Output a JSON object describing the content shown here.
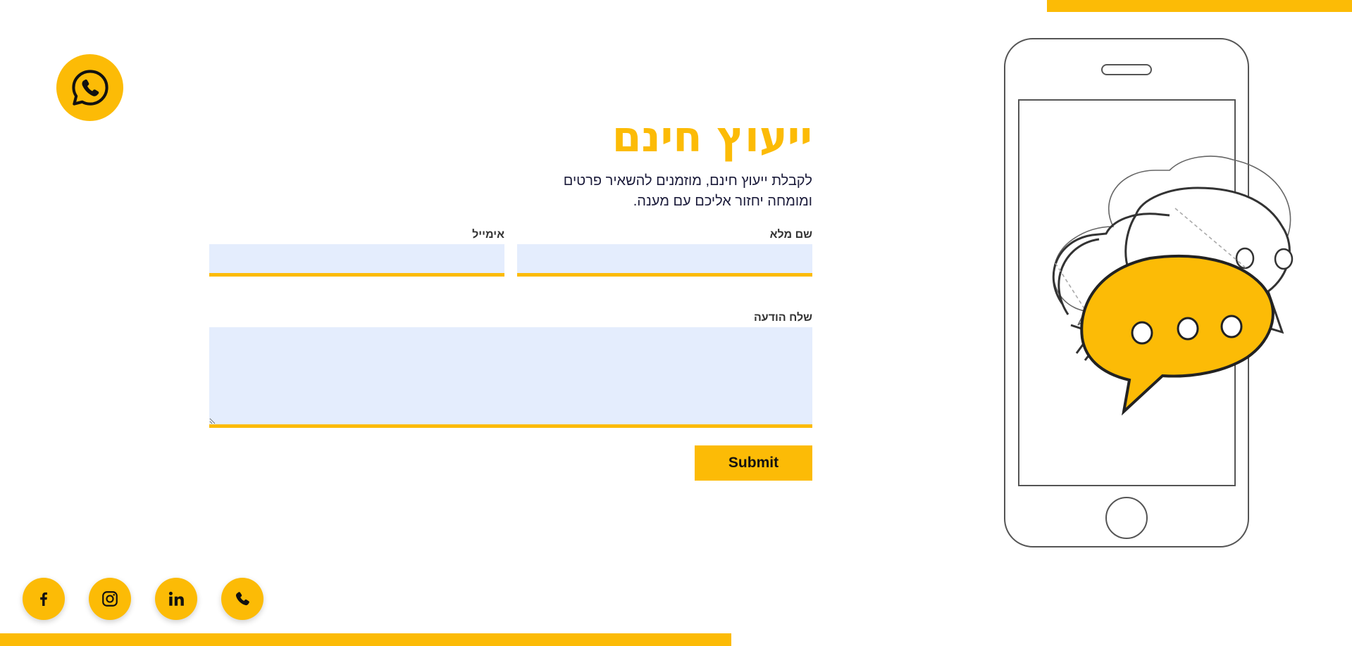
{
  "hero": {
    "title": "ייעוץ חינם",
    "subtitle_line1": "לקבלת ייעוץ חינם, מוזמנים להשאיר פרטים",
    "subtitle_line2": "ומומחה יחזור אליכם עם מענה."
  },
  "form": {
    "name_label": "שם מלא",
    "name_value": "",
    "email_label": "אימייל",
    "email_value": "",
    "message_label": "שלח הודעה",
    "message_value": "",
    "submit_label": "Submit"
  },
  "floating": {
    "whatsapp_icon": "whatsapp-icon"
  },
  "socials": [
    {
      "name": "facebook",
      "icon": "facebook-icon"
    },
    {
      "name": "instagram",
      "icon": "instagram-icon"
    },
    {
      "name": "linkedin",
      "icon": "linkedin-icon"
    },
    {
      "name": "phone",
      "icon": "phone-icon"
    }
  ],
  "colors": {
    "accent": "#FCBB06",
    "input_bg": "#E4EDFD",
    "text_dark": "#1b1b3a",
    "outline": "#555555"
  }
}
